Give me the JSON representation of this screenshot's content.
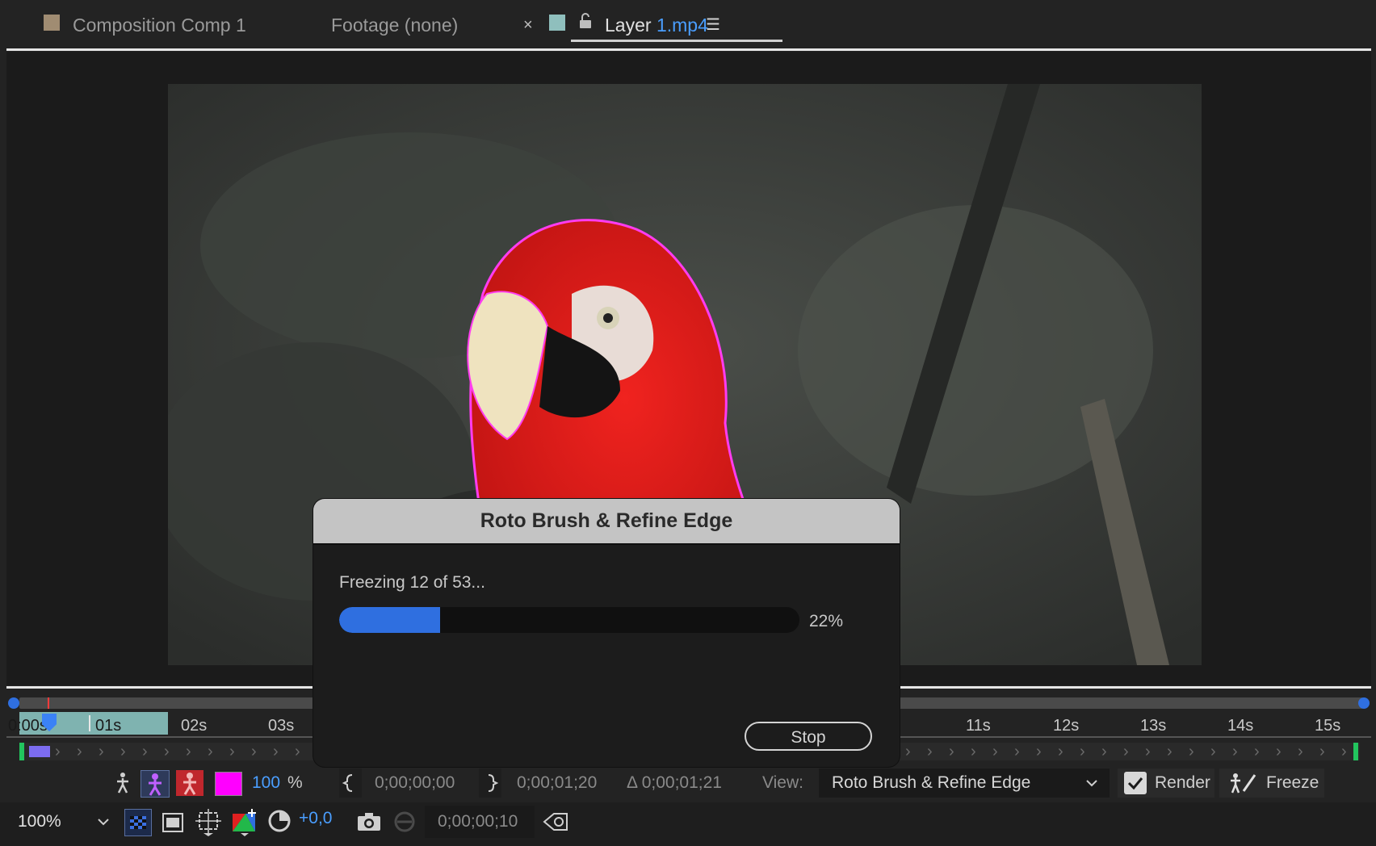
{
  "tabs": {
    "composition": "Composition Comp 1",
    "footage": "Footage (none)",
    "layer_prefix": "Layer",
    "layer_file": "1.mp4",
    "close": "×",
    "menu": "☰"
  },
  "timeline": {
    "ticks": [
      "0:00s",
      "01s",
      "02s",
      "03s",
      "11s",
      "12s",
      "13s",
      "14s",
      "15s"
    ]
  },
  "roto_bar": {
    "zoom_value": "100",
    "zoom_unit": "%",
    "in_time": "0;00;00;00",
    "out_time": "0;00;01;20",
    "duration": "Δ 0;00;01;21",
    "view_label": "View:",
    "view_value": "Roto Brush & Refine Edge",
    "render_label": "Render",
    "freeze_label": "Freeze",
    "overlay_color": "#ff00ff"
  },
  "bottom_bar": {
    "magnification": "100%",
    "exposure": "+0,0",
    "current_time": "0;00;00;10"
  },
  "dialog": {
    "title": "Roto Brush & Refine Edge",
    "status": "Freezing 12 of 53...",
    "progress_percent": 22,
    "progress_label": "22%",
    "stop_label": "Stop"
  },
  "colors": {
    "accent": "#2f6fe0",
    "link": "#4a9eff",
    "cached": "#7fb3b0",
    "parrot_red": "#e3161b"
  },
  "icons": [
    "composition-swatch-icon",
    "layer-swatch-icon",
    "lock-icon",
    "panel-menu-icon",
    "in-point-icon",
    "out-point-icon",
    "checkbox-icon",
    "freeze-icon",
    "camera-icon",
    "transparency-grid-icon",
    "region-of-interest-icon",
    "safe-zones-icon",
    "channel-icon",
    "exposure-reset-icon",
    "snapshot-icon",
    "show-snapshot-icon",
    "timecode-icon"
  ]
}
